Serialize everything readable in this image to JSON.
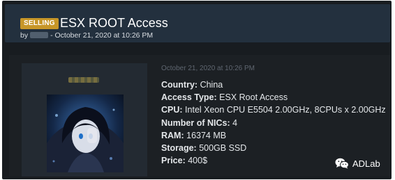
{
  "thread": {
    "badge": "SELLING",
    "title": "ESX ROOT Access",
    "byline_prefix": "by",
    "byline_date": "- October 21, 2020 at 10:26 PM"
  },
  "post": {
    "date": "October 21, 2020 at 10:26 PM",
    "fields": [
      {
        "label": "Country:",
        "value": "China"
      },
      {
        "label": "Access Type:",
        "value": "ESX Root Access"
      },
      {
        "label": "CPU:",
        "value": "Intel Xeon CPU E5504 2.00GHz, 8CPUs x 2.00GHz"
      },
      {
        "label": "Number of NICs:",
        "value": "4"
      },
      {
        "label": "RAM:",
        "value": "16374 MB"
      },
      {
        "label": "Storage:",
        "value": "500GB SSD"
      },
      {
        "label": "Price:",
        "value": "400$"
      }
    ]
  },
  "watermark": {
    "text": "ADLab",
    "icon": "wechat-icon"
  },
  "colors": {
    "badge": "#c79628",
    "header": "#23303e",
    "background": "#181c20"
  }
}
